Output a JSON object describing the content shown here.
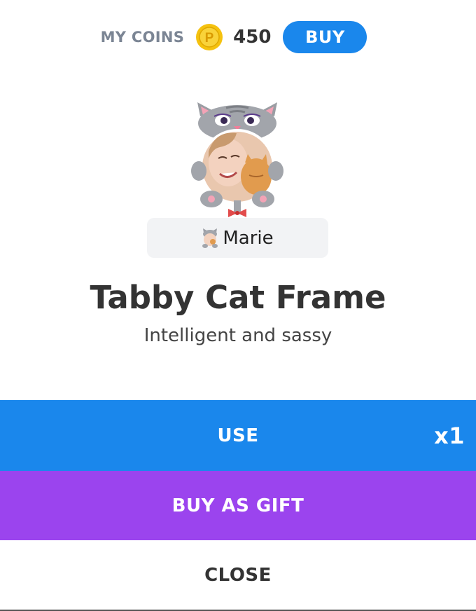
{
  "header": {
    "coins_label": "MY COINS",
    "coin_icon": "gold-coin-icon",
    "coin_letter": "P",
    "coin_count": "450",
    "buy_label": "BUY"
  },
  "preview": {
    "frame_image": "tabby-cat-frame-avatar",
    "username": "Marie",
    "username_icon": "cat-badge-icon"
  },
  "item": {
    "title": "Tabby Cat Frame",
    "subtitle": "Intelligent and sassy"
  },
  "actions": {
    "use_label": "USE",
    "use_quantity": "x1",
    "gift_label": "BUY AS GIFT",
    "close_label": "CLOSE"
  },
  "colors": {
    "primary_blue": "#1a87ec",
    "gift_purple": "#9b44ee",
    "coin_gold": "#f5c20f",
    "muted_label": "#7b8594"
  }
}
